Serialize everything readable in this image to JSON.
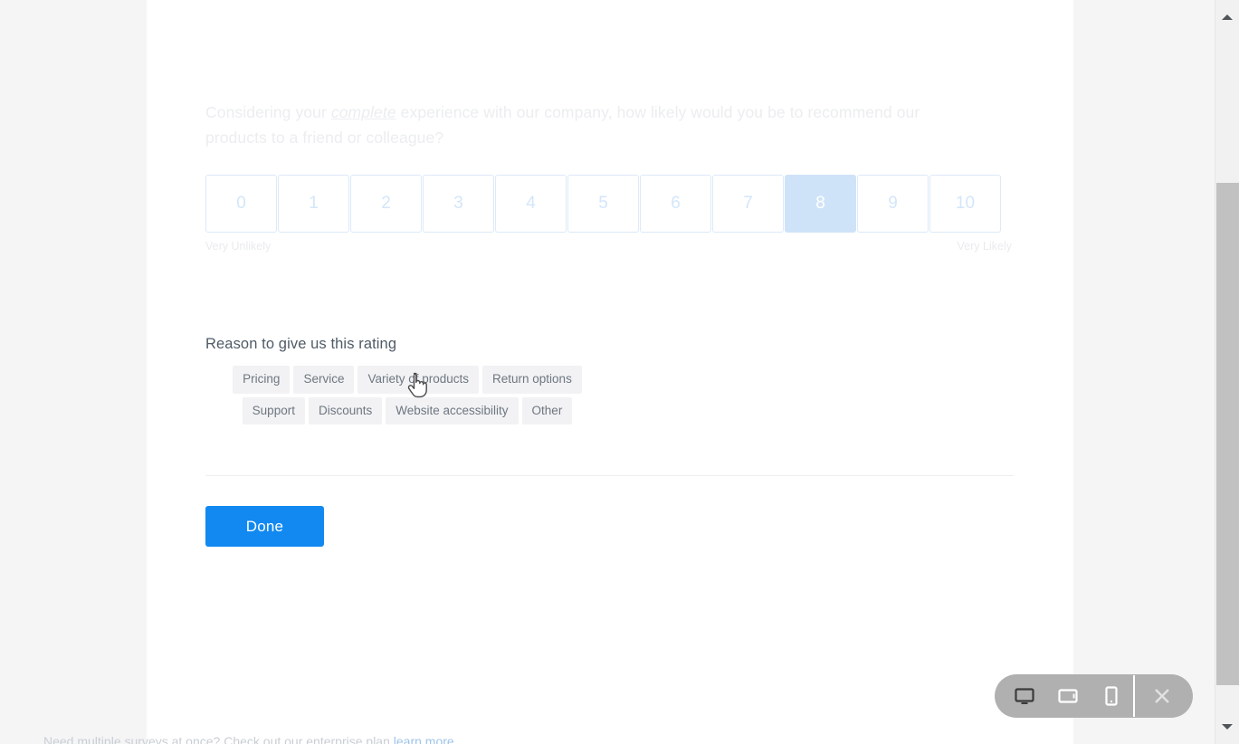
{
  "survey": {
    "question": {
      "prefix": "Considering your ",
      "emphasis": "complete",
      "suffix": " experience with our company, how likely would you be to recommend our products to a friend or colleague?"
    },
    "nps": {
      "options": [
        "0",
        "1",
        "2",
        "3",
        "4",
        "5",
        "6",
        "7",
        "8",
        "9",
        "10"
      ],
      "selected": "8",
      "low_label": "Very Unlikely",
      "high_label": "Very Likely",
      "selected_bg": "#cfe3f8",
      "border_color": "#ddeaf8",
      "number_color": "#d3e6fa"
    },
    "reason": {
      "title": "Reason to give us this rating",
      "tags": [
        "Pricing",
        "Service",
        "Variety of products",
        "Return options",
        "Support",
        "Discounts",
        "Website accessibility",
        "Other"
      ],
      "tag_bg": "#f2f2f4",
      "tag_text_color": "#6e7781"
    },
    "submit": {
      "label": "Done",
      "color": "#1289f0"
    }
  },
  "footer": {
    "text": "Need multiple surveys at once? Check out our enterprise plan",
    "link": "learn more"
  },
  "device_toolbar": {
    "buttons": [
      {
        "icon": "desktop-icon",
        "label": "Desktop",
        "active": true
      },
      {
        "icon": "tablet-icon",
        "label": "Tablet",
        "active": false
      },
      {
        "icon": "mobile-icon",
        "label": "Mobile",
        "active": false
      }
    ],
    "close_label": "Close",
    "close_icon": "close-icon",
    "background": "#b0b0b0"
  },
  "scrollbar": {
    "up_icon": "scroll-up-arrow-icon",
    "down_icon": "scroll-down-arrow-icon",
    "thumb_color": "#c1c1c1"
  }
}
